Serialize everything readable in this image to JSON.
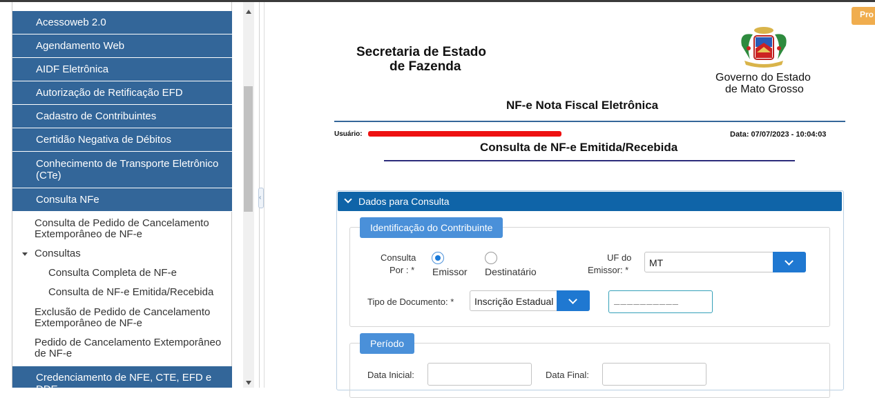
{
  "sidebar": {
    "items": [
      {
        "label": "Acessoweb 2.0"
      },
      {
        "label": "Agendamento Web"
      },
      {
        "label": "AIDF Eletrônica"
      },
      {
        "label": "Autorização de Retificação EFD"
      },
      {
        "label": "Cadastro de Contribuintes"
      },
      {
        "label": "Certidão Negativa de Débitos"
      },
      {
        "label": "Conhecimento de Transporte Eletrônico (CTe)"
      },
      {
        "label": "Consulta NFe"
      }
    ],
    "sub": {
      "cancel_request_query": "Consulta de Pedido de Cancelamento Extemporâneo de NF-e",
      "consultas": "Consultas",
      "full_query": "Consulta Completa de NF-e",
      "emitted_received": "Consulta de NF-e Emitida/Recebida",
      "cancel_exclusion": "Exclusão de Pedido de Cancelamento Extemporâneo de NF-e",
      "cancel_request": "Pedido de Cancelamento Extemporâneo de NF-e"
    },
    "bottom_item": "Credenciamento de NFE, CTE, EFD e DDE"
  },
  "header": {
    "proc_button": "Pro",
    "secretaria_line1": "Secretaria de Estado",
    "secretaria_line2": "de Fazenda",
    "gov_line1": "Governo do Estado",
    "gov_line2": "de Mato Grosso",
    "nfe_title": "NF-e Nota Fiscal Eletrônica",
    "usuario_label": "Usuário:",
    "data_label": "Data: 07/07/2023 - 10:04:03",
    "page_title": "Consulta de NF-e Emitida/Recebida"
  },
  "form": {
    "panel_title": "Dados para Consulta",
    "ident_legend": "Identificação do Contribuinte",
    "consulta_por_1": "Consulta",
    "consulta_por_2": "Por :  *",
    "emissor": "Emissor",
    "destinatario": "Destinatário",
    "uf_label_1": "UF do",
    "uf_label_2": "Emissor:  *",
    "uf_value": "MT",
    "tipo_doc_label": "Tipo de Documento:  *",
    "tipo_doc_value": "Inscrição Estadual",
    "doc_mask": "__________",
    "periodo_legend": "Período",
    "data_inicial": "Data Inicial:",
    "data_final": "Data Final:"
  },
  "colors": {
    "nav_blue": "#336699",
    "panel_blue": "#0f64a8",
    "legend_blue": "#4a90d9",
    "accent_orange": "#f0ad4e"
  }
}
